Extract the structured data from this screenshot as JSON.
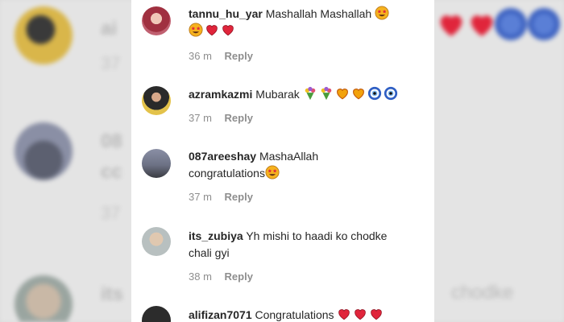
{
  "comments": [
    {
      "username": "tannu_hu_yar",
      "text": "Mashallah Mashallah",
      "emojis_inline": [
        "star-struck"
      ],
      "emojis_line2": [
        "star-struck",
        "heart",
        "heart"
      ],
      "time": "36 m",
      "reply": "Reply"
    },
    {
      "username": "azramkazmi",
      "text": "Mubarak",
      "emojis_inline": [
        "bouquet",
        "bouquet",
        "heart-gold",
        "heart-gold",
        "evil-eye",
        "evil-eye"
      ],
      "time": "37 m",
      "reply": "Reply"
    },
    {
      "username": "087areeshay",
      "text": "MashaAllah",
      "line2": "congratulations",
      "emojis_line2": [
        "star-struck"
      ],
      "time": "37 m",
      "reply": "Reply"
    },
    {
      "username": "its_zubiya",
      "text": "Yh mishi to haadi ko chodke",
      "line2": "chali gyi",
      "time": "38 m",
      "reply": "Reply"
    },
    {
      "username": "alifizan7071",
      "text": "Congratulations",
      "emojis_inline": [
        "heart",
        "heart",
        "heart"
      ]
    }
  ],
  "colors": {
    "heart": "#e0253b",
    "star": "#f6b21e",
    "evil_eye": "#2f5fc4",
    "panel": "#ffffff",
    "muted": "#8e8e8e"
  }
}
